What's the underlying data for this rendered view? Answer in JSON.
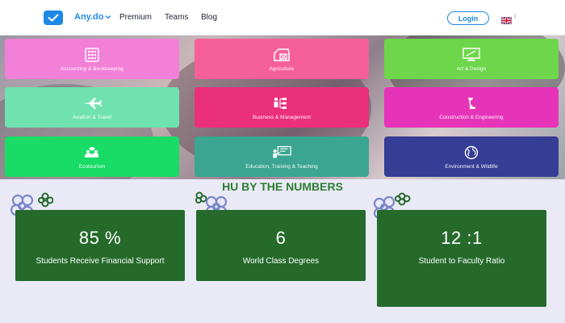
{
  "nav": {
    "brand": "Any.do",
    "links": [
      "Premium",
      "Teams",
      "Blog"
    ],
    "login": "Login",
    "language_code": "I",
    "flag_icon": "uk-flag-icon",
    "logo_icon": "checkmark-icon"
  },
  "categories": [
    {
      "label": "Accounting & Bookkeeping",
      "icon": "calculator-icon",
      "color": "#f27fd8"
    },
    {
      "label": "Agriculture",
      "icon": "barn-icon",
      "color": "#f5609a"
    },
    {
      "label": "Art & Design",
      "icon": "monitor-icon",
      "color": "#6ed64b"
    },
    {
      "label": "Aviation & Travel",
      "icon": "airplane-icon",
      "color": "#6fe2b0"
    },
    {
      "label": "Business & Management",
      "icon": "org-chart-icon",
      "color": "#ea2f7b"
    },
    {
      "label": "Construction & Engineering",
      "icon": "crane-icon",
      "color": "#e634b9"
    },
    {
      "label": "Ecotourism",
      "icon": "eco-hands-icon",
      "color": "#19dc66"
    },
    {
      "label": "Education, Training & Teaching",
      "icon": "teacher-board-icon",
      "color": "#3ba591"
    },
    {
      "label": "Environment & Wildlife",
      "icon": "globe-icon",
      "color": "#353d95"
    }
  ],
  "numbers": {
    "title": "HU BY THE NUMBERS",
    "stats": [
      {
        "value": "85 %",
        "caption": "Students Receive Financial Support"
      },
      {
        "value": "6",
        "caption": "World Class Degrees"
      },
      {
        "value": "12 :1",
        "caption": "Student to Faculty Ratio"
      }
    ]
  },
  "colors": {
    "brand": "#1e88e5",
    "stat_background": "#256a2b",
    "section_title": "#2e7d32"
  }
}
